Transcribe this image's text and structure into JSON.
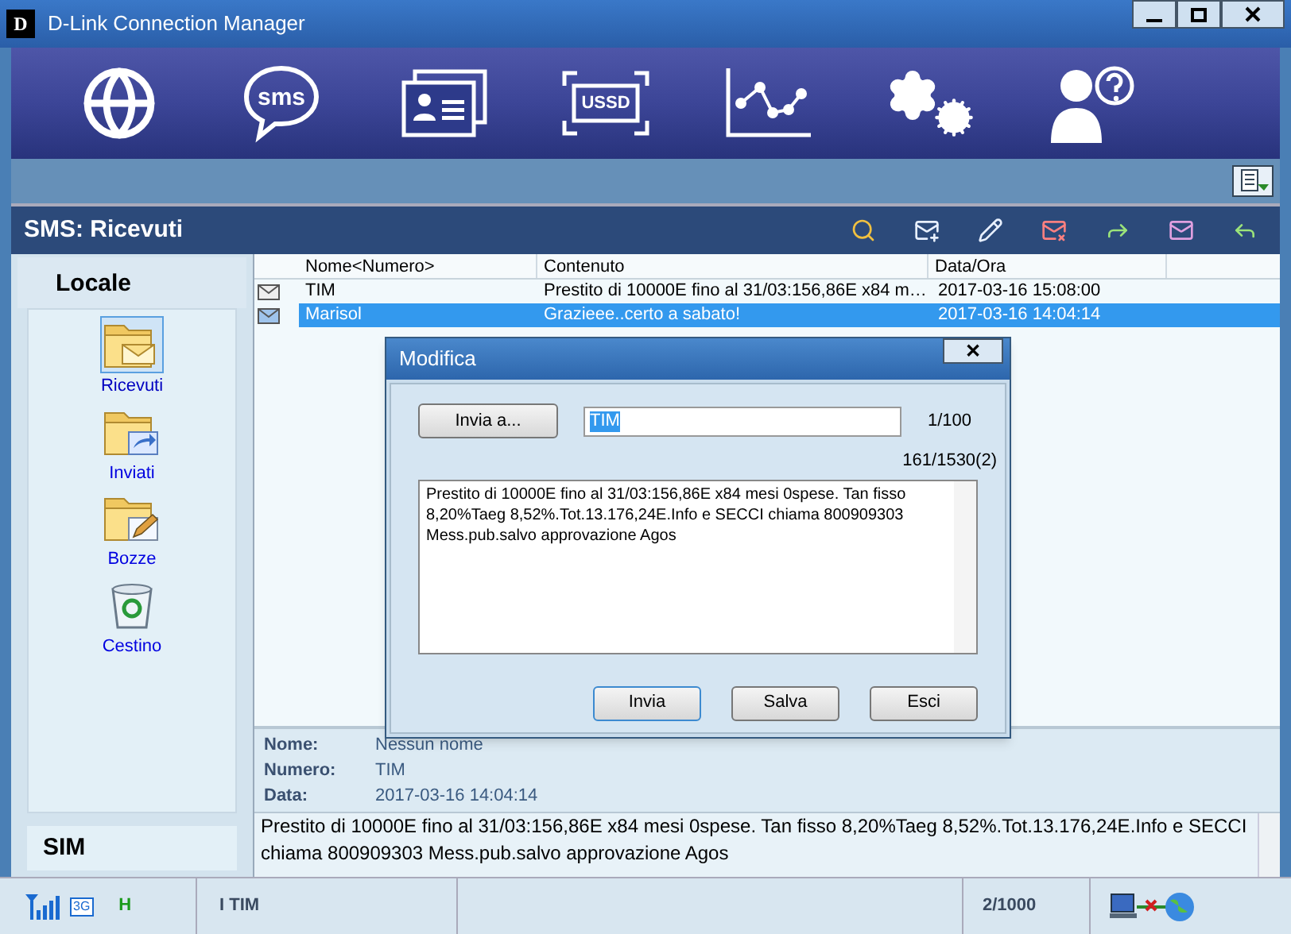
{
  "window": {
    "logo": "D",
    "title": "D-Link Connection Manager"
  },
  "toolbar": [
    {
      "kind": "globe"
    },
    {
      "kind": "sms",
      "label": "sms"
    },
    {
      "kind": "contacts"
    },
    {
      "kind": "ussd",
      "label": "USSD"
    },
    {
      "kind": "chart"
    },
    {
      "kind": "settings"
    },
    {
      "kind": "help"
    }
  ],
  "section_title": "SMS: Ricevuti",
  "actions": [
    {
      "kind": "search"
    },
    {
      "kind": "new"
    },
    {
      "kind": "edit"
    },
    {
      "kind": "delete"
    },
    {
      "kind": "forward"
    },
    {
      "kind": "move"
    },
    {
      "kind": "reply"
    }
  ],
  "sidebar": {
    "title": "Locale",
    "folders": [
      {
        "label": "Ricevuti",
        "kind": "inbox",
        "selected": true
      },
      {
        "label": "Inviati",
        "kind": "sent",
        "selected": false
      },
      {
        "label": "Bozze",
        "kind": "drafts",
        "selected": false
      },
      {
        "label": "Cestino",
        "kind": "trash",
        "selected": false
      }
    ],
    "bottom": "SIM"
  },
  "table": {
    "columns": [
      "Nome<Numero>",
      "Contenuto",
      "Data/Ora"
    ],
    "rows": [
      {
        "name": "TIM",
        "content": "Prestito di 10000E fino al 31/03:156,86E x84 m…",
        "date": "2017-03-16 15:08:00",
        "selected": false
      },
      {
        "name": "Marisol",
        "content": "Grazieee..certo a sabato!",
        "date": "2017-03-16 14:04:14",
        "selected": true
      }
    ]
  },
  "details": {
    "fields": [
      {
        "label": "Nome:",
        "value": "Nessun nome"
      },
      {
        "label": "Numero:",
        "value": "TIM"
      },
      {
        "label": "Data:",
        "value": "2017-03-16 14:04:14"
      }
    ],
    "message": "Prestito di 10000E fino al 31/03:156,86E x84 mesi 0spese. Tan fisso 8,20%Taeg 8,52%.Tot.13.176,24E.Info e SECCI chiama 800909303 Mess.pub.salvo approvazione Agos"
  },
  "dialog": {
    "title": "Modifica",
    "close": "✕",
    "send_to": "Invia a...",
    "recipient": "TIM",
    "recipient_count": "1/100",
    "char_count": "161/1530(2)",
    "body": "Prestito di 10000E fino al 31/03:156,86E x84 mesi 0spese. Tan fisso 8,20%Taeg 8,52%.Tot.13.176,24E.Info e SECCI chiama 800909303 Mess.pub.salvo approvazione Agos",
    "buttons": [
      "Invia",
      "Salva",
      "Esci"
    ]
  },
  "status_bar": {
    "network_badge": "3G",
    "mode_badge": "H",
    "operator": "I TIM",
    "sms_count": "2/1000"
  }
}
